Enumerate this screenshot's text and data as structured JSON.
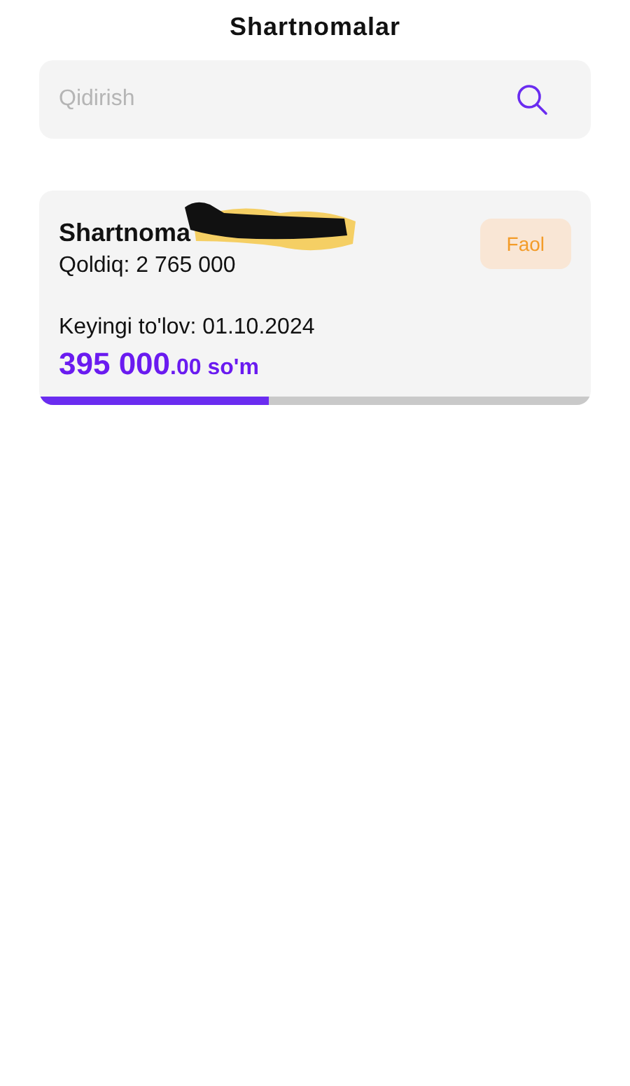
{
  "header": {
    "title": "Shartnomalar"
  },
  "search": {
    "placeholder": "Qidirish"
  },
  "contracts": [
    {
      "title": "Shartnoma",
      "redacted": true,
      "status": "Faol",
      "balance": "Qoldiq: 2 765 000",
      "next_payment": "Keyingi to'lov: 01.10.2024",
      "amount": "395 000",
      "amount_decimals": ".00",
      "currency": "so'm",
      "level": 0.415
    }
  ]
}
